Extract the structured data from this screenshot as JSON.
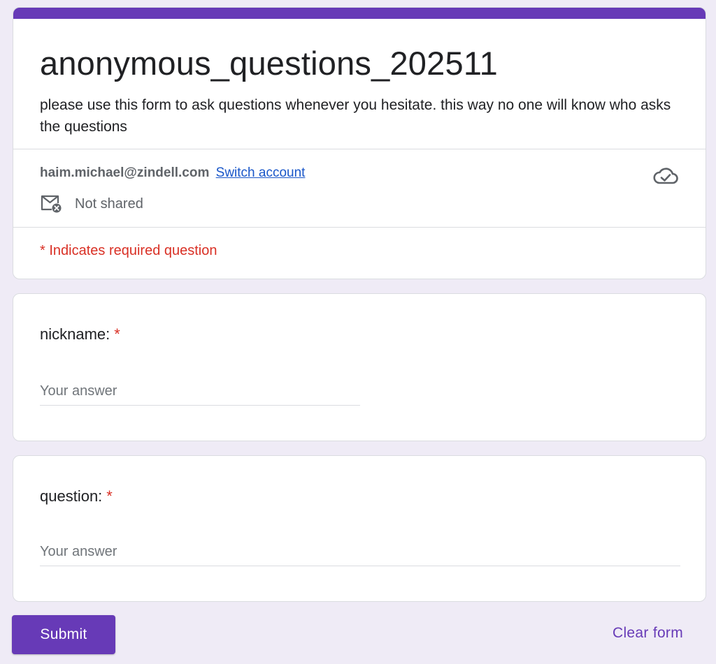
{
  "form": {
    "title": "anonymous_questions_202511",
    "description": "please use this form to ask questions whenever you hesitate. this way no one will know who asks the questions",
    "accent_color": "#673ab7"
  },
  "account": {
    "email": "haim.michael@zindell.com",
    "switch_label": "Switch account",
    "sharing_status": "Not shared",
    "status_icon": "cloud-done-icon",
    "sharing_icon": "mail-not-shared-icon"
  },
  "required_note": "* Indicates required question",
  "questions": [
    {
      "label": "nickname:",
      "required_marker": "*",
      "placeholder": "Your answer",
      "value": ""
    },
    {
      "label": "question:",
      "required_marker": "*",
      "placeholder": "Your answer",
      "value": ""
    }
  ],
  "actions": {
    "submit_label": "Submit",
    "clear_label": "Clear form"
  }
}
